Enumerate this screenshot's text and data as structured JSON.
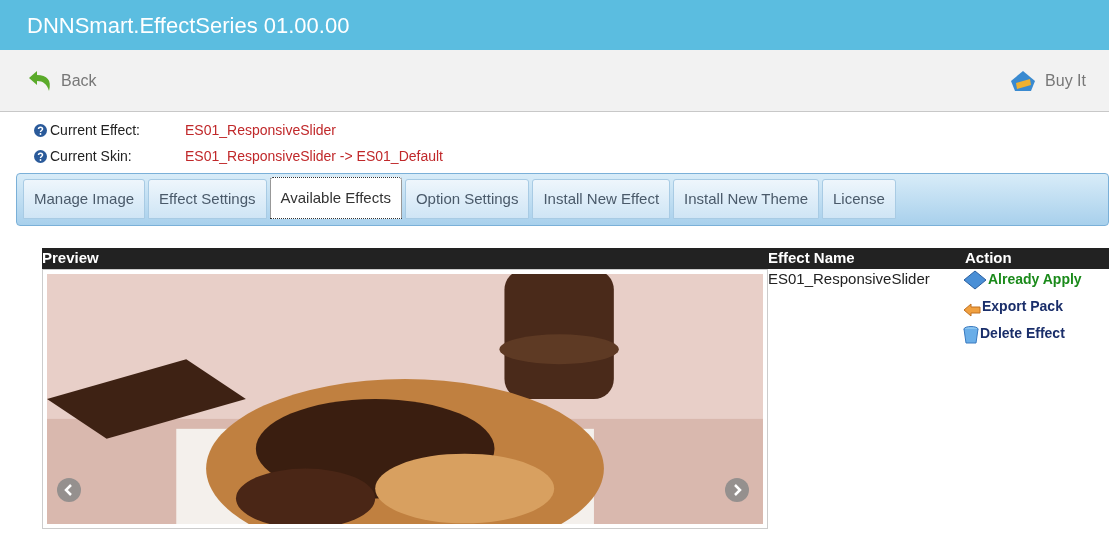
{
  "window": {
    "title": "DNNSmart.EffectSeries 01.00.00"
  },
  "toolbar": {
    "back": "Back",
    "buy": "Buy It"
  },
  "info": [
    {
      "label": "Current Effect:",
      "value": "ES01_ResponsiveSlider"
    },
    {
      "label": "Current Skin:",
      "value": "ES01_ResponsiveSlider -> ES01_Default"
    }
  ],
  "tabs": [
    {
      "label": "Manage Image",
      "selected": false
    },
    {
      "label": "Effect Settings",
      "selected": false
    },
    {
      "label": "Available Effects",
      "selected": true
    },
    {
      "label": "Option Settings",
      "selected": false
    },
    {
      "label": "Install New Effect",
      "selected": false
    },
    {
      "label": "Install New Theme",
      "selected": false
    },
    {
      "label": "License",
      "selected": false
    }
  ],
  "table": {
    "columns": [
      "Preview",
      "Effect Name",
      "Action"
    ],
    "rows": [
      {
        "name": "ES01_ResponsiveSlider",
        "actions": [
          {
            "kind": "applied",
            "label": "Already Apply"
          },
          {
            "kind": "export",
            "label": "Export Pack"
          },
          {
            "kind": "delete",
            "label": "Delete Effect"
          }
        ]
      }
    ]
  }
}
